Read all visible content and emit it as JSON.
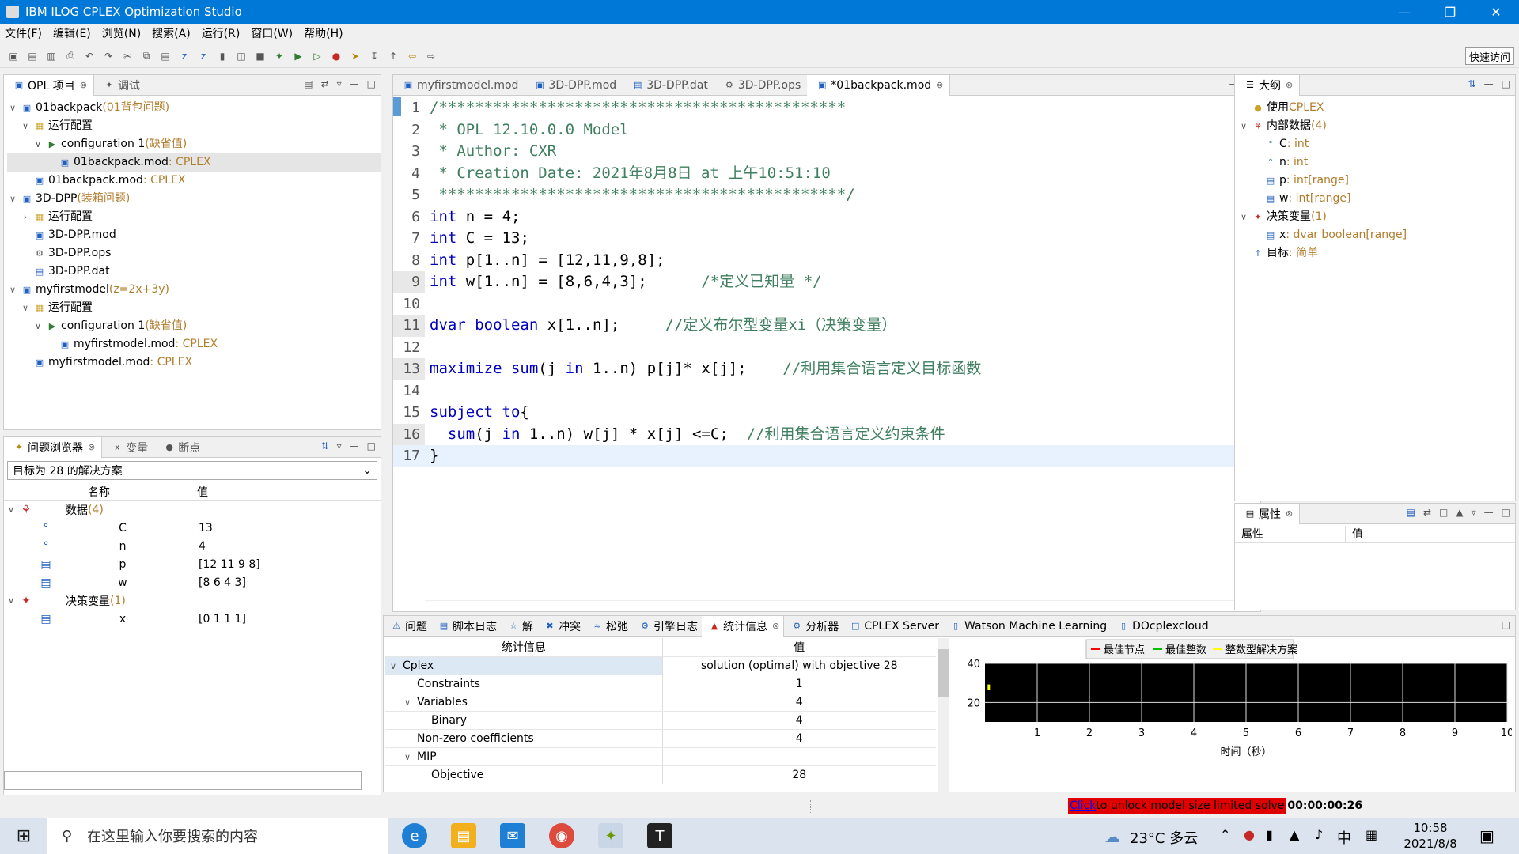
{
  "window": {
    "title": "IBM ILOG CPLEX Optimization Studio"
  },
  "menu": [
    "文件(F)",
    "编辑(E)",
    "浏览(N)",
    "搜索(A)",
    "运行(R)",
    "窗口(W)",
    "帮助(H)"
  ],
  "quick_access": "快速访问",
  "opl_panel": {
    "tabs": [
      "OPL 项目",
      "调试"
    ],
    "tree": [
      {
        "label": "01backpack",
        "note": "(01背包问题)",
        "level": 0,
        "icon": "project-icon"
      },
      {
        "label": "运行配置",
        "note": "",
        "level": 1,
        "icon": "folder-icon"
      },
      {
        "label": "configuration 1",
        "note": "(缺省值)",
        "level": 2,
        "icon": "config-icon"
      },
      {
        "label": "01backpack.mod",
        "note": " : CPLEX",
        "level": 3,
        "icon": "mod-file-icon",
        "selected": true
      },
      {
        "label": "01backpack.mod",
        "note": " : CPLEX",
        "level": 1,
        "icon": "mod-file-icon"
      },
      {
        "label": "3D-DPP",
        "note": "(装箱问题)",
        "level": 0,
        "icon": "project-icon"
      },
      {
        "label": "运行配置",
        "note": "",
        "level": 1,
        "icon": "folder-icon"
      },
      {
        "label": "3D-DPP.mod",
        "note": "",
        "level": 1,
        "icon": "mod-file-icon"
      },
      {
        "label": "3D-DPP.ops",
        "note": "",
        "level": 1,
        "icon": "ops-file-icon"
      },
      {
        "label": "3D-DPP.dat",
        "note": "",
        "level": 1,
        "icon": "dat-file-icon"
      },
      {
        "label": "myfirstmodel",
        "note": "(z=2x+3y)",
        "level": 0,
        "icon": "project-icon"
      },
      {
        "label": "运行配置",
        "note": "",
        "level": 1,
        "icon": "folder-icon"
      },
      {
        "label": "configuration 1",
        "note": "(缺省值)",
        "level": 2,
        "icon": "config-icon"
      },
      {
        "label": "myfirstmodel.mod",
        "note": " : CPLEX",
        "level": 3,
        "icon": "mod-file-icon"
      },
      {
        "label": "myfirstmodel.mod",
        "note": " : CPLEX",
        "level": 1,
        "icon": "mod-file-icon"
      }
    ]
  },
  "problem_panel": {
    "tabs": [
      "问题浏览器",
      "变量",
      "断点"
    ],
    "selector": "目标为 28 的解决方案",
    "col_name": "名称",
    "col_value": "值",
    "rows": [
      {
        "name": "数据",
        "note": "(4)",
        "value": "",
        "group": true
      },
      {
        "name": "C",
        "value": "13"
      },
      {
        "name": "n",
        "value": "4"
      },
      {
        "name": "p",
        "value": "[12 11 9 8]"
      },
      {
        "name": "w",
        "value": "[8 6 4 3]"
      },
      {
        "name": "决策变量",
        "note": "(1)",
        "value": "",
        "group": true
      },
      {
        "name": "x",
        "value": "[0 1 1 1]"
      }
    ]
  },
  "editor": {
    "tabs": [
      "myfirstmodel.mod",
      "3D-DPP.mod",
      "3D-DPP.dat",
      "3D-DPP.ops",
      "*01backpack.mod"
    ],
    "lines": [
      "/*********************************************",
      " * OPL 12.10.0.0 Model",
      " * Author: CXR",
      " * Creation Date: 2021年8月8日 at 上午10:51:10",
      " *********************************************/",
      "int n = 4;",
      "int C = 13;",
      "int p[1..n] = [12,11,9,8];",
      "int w[1..n] = [8,6,4,3];      /*定义已知量 */",
      "",
      "dvar boolean x[1..n];     //定义布尔型变量xi（决策变量）",
      "",
      "maximize sum(j in 1..n) p[j]* x[j];    //利用集合语言定义目标函数",
      "",
      "subject to{",
      "  sum(j in 1..n) w[j] * x[j] <=C;  //利用集合语言定义约束条件",
      "}"
    ]
  },
  "outline_panel": {
    "tab": "大纲",
    "items": [
      {
        "label": "使用",
        "value": "CPLEX",
        "level": 0
      },
      {
        "label": "内部数据",
        "value": "(4)",
        "level": 0
      },
      {
        "label": "C",
        "value": " : int",
        "level": 1
      },
      {
        "label": "n",
        "value": " : int",
        "level": 1
      },
      {
        "label": "p",
        "value": " : int[range]",
        "level": 1
      },
      {
        "label": "w",
        "value": " : int[range]",
        "level": 1
      },
      {
        "label": "决策变量",
        "value": "(1)",
        "level": 0
      },
      {
        "label": "x",
        "value": " : dvar boolean[range]",
        "level": 1
      },
      {
        "label": "目标",
        "value": " : 简单",
        "level": 0
      }
    ]
  },
  "props_panel": {
    "tab": "属性",
    "col1": "属性",
    "col2": "值"
  },
  "bottom_tabs": [
    "问题",
    "脚本日志",
    "解",
    "冲突",
    "松弛",
    "引擎日志",
    "统计信息",
    "分析器",
    "CPLEX Server",
    "Watson Machine Learning",
    "DOcplexcloud"
  ],
  "stats": {
    "col_info": "统计信息",
    "col_value": "值",
    "rows": [
      {
        "label": "Cplex",
        "value": "solution (optimal) with objective 28",
        "level": 0
      },
      {
        "label": "Constraints",
        "value": "1",
        "level": 1
      },
      {
        "label": "Variables",
        "value": "4",
        "level": 1
      },
      {
        "label": "Binary",
        "value": "4",
        "level": 2
      },
      {
        "label": "Non-zero coefficients",
        "value": "4",
        "level": 1
      },
      {
        "label": "MIP",
        "value": "",
        "level": 1
      },
      {
        "label": "Objective",
        "value": "28",
        "level": 2
      }
    ]
  },
  "chart_data": {
    "type": "line",
    "legend": [
      "最佳节点",
      "最佳整数",
      "整数型解决方案"
    ],
    "legend_colors": [
      "#ff0000",
      "#00c000",
      "#ffff00"
    ],
    "y_ticks": [
      "40",
      "20"
    ],
    "x_ticks": [
      "1",
      "2",
      "3",
      "4",
      "5",
      "6",
      "7",
      "8",
      "9",
      "10"
    ],
    "xlabel": "时间（秒）",
    "ylim": [
      10,
      40
    ],
    "xlim": [
      0,
      10
    ],
    "points": [
      {
        "series": "整数型解决方案",
        "x": 0.05,
        "y": 28
      }
    ]
  },
  "status": {
    "link": "Click",
    "message": " to unlock model size limited solve",
    "time": "00:00:00:26"
  },
  "taskbar": {
    "search_placeholder": "在这里输入你要搜索的内容",
    "weather": "23°C 多云",
    "ime": "中",
    "time": "10:58",
    "date": "2021/8/8"
  }
}
